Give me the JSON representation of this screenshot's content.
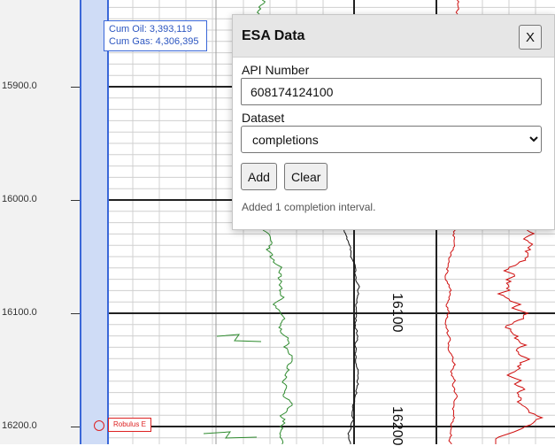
{
  "depth_axis": {
    "labels": [
      {
        "value": "15900.0",
        "depth": 15900
      },
      {
        "value": "16000.0",
        "depth": 16000
      },
      {
        "value": "16100.0",
        "depth": 16100
      },
      {
        "value": "16200.0",
        "depth": 16200
      }
    ]
  },
  "track_depth_labels": [
    "16100",
    "16200"
  ],
  "tooltip": {
    "cum_oil": "Cum Oil: 3,393,119",
    "cum_gas": "Cum Gas: 4,306,395"
  },
  "formation_marker": {
    "label": "Robulus E",
    "color": "#dd2222"
  },
  "esa_panel": {
    "title": "ESA Data",
    "close_label": "X",
    "api_label": "API Number",
    "api_value": "608174124100",
    "dataset_label": "Dataset",
    "dataset_value": "completions",
    "dataset_options": [
      "completions"
    ],
    "add_label": "Add",
    "clear_label": "Clear",
    "status": "Added 1 completion interval."
  },
  "colors": {
    "completion_band": "#cfdcf6",
    "completion_border": "#3a67d8",
    "gamma_curve": "#2e8b2e",
    "resistivity_curve": "#d01010"
  }
}
